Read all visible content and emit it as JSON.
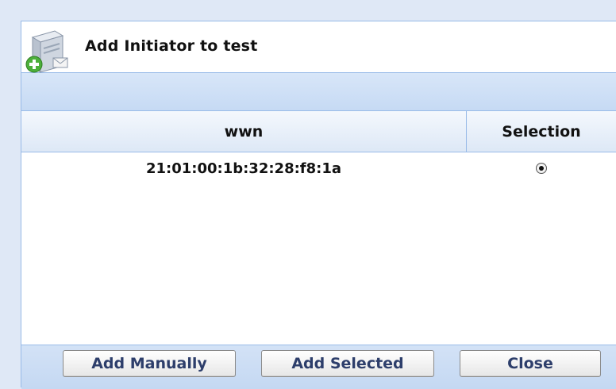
{
  "dialog": {
    "title": "Add Initiator to test",
    "icon": "server-add-icon"
  },
  "grid": {
    "columns": [
      "wwn",
      "Selection"
    ],
    "rows": [
      {
        "wwn": "21:01:00:1b:32:28:f8:1a",
        "selected": true
      }
    ]
  },
  "buttons": {
    "add_manually": "Add Manually",
    "add_selected": "Add Selected",
    "close": "Close"
  },
  "colors": {
    "border": "#99bbe8",
    "toolbar": "#c6daf4",
    "button_text": "#2d3e6b"
  }
}
